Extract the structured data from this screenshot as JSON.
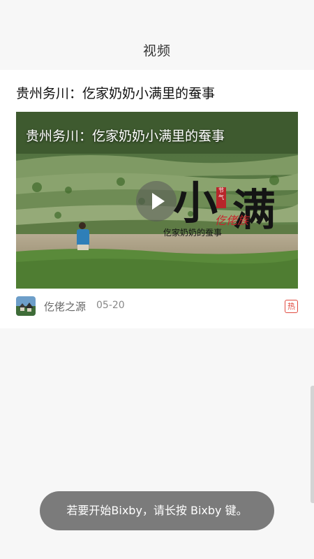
{
  "header": {
    "title": "视频"
  },
  "article": {
    "title": "贵州务川：仡家奶奶小满里的蚕事",
    "video": {
      "overlay_title": "贵州务川：仡家奶奶小满里的蚕事",
      "play_icon": "play-icon",
      "logo": {
        "main_left": "小",
        "main_right": "满",
        "tribe": "仡佬族",
        "subtitle": "仡家奶奶的蚕事",
        "stamp": "节气"
      }
    },
    "meta": {
      "source_name": "仡佬之源",
      "date": "05-20",
      "badge": "热"
    }
  },
  "toast": {
    "text": "若要开始Bixby，请长按 Bixby 键。"
  },
  "colors": {
    "background": "#f7f7f7",
    "card": "#ffffff",
    "hot_badge": "#e04a3f",
    "toast": "#7b7b7b"
  }
}
